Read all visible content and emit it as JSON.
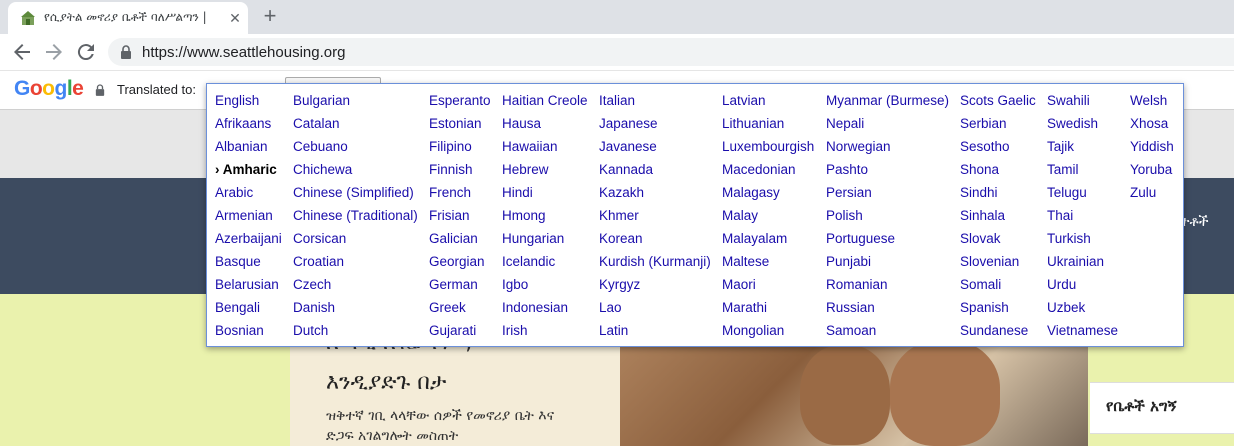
{
  "browser": {
    "tab": {
      "title": "የሲያትል መኖሪያ ቤቶች ባለሥልጣን |",
      "favicon": "house-icon"
    },
    "new_tab_icon": "plus-icon",
    "close_icon": "close-icon",
    "back_icon": "back-arrow-icon",
    "forward_icon": "forward-arrow-icon",
    "reload_icon": "reload-icon",
    "url": "https://www.seattlehousing.org"
  },
  "translate_bar": {
    "logo_letters": [
      "G",
      "o",
      "o",
      "g",
      "l",
      "e"
    ],
    "label": "Translated to:",
    "selected_language": "Amharic"
  },
  "language_menu": {
    "columns": [
      [
        "English",
        "Afrikaans",
        "Albanian",
        "Amharic",
        "Arabic",
        "Armenian",
        "Azerbaijani",
        "Basque",
        "Belarusian",
        "Bengali",
        "Bosnian"
      ],
      [
        "Bulgarian",
        "Catalan",
        "Cebuano",
        "Chichewa",
        "Chinese (Simplified)",
        "Chinese (Traditional)",
        "Corsican",
        "Croatian",
        "Czech",
        "Danish",
        "Dutch"
      ],
      [
        "Esperanto",
        "Estonian",
        "Filipino",
        "Finnish",
        "French",
        "Frisian",
        "Galician",
        "Georgian",
        "German",
        "Greek",
        "Gujarati"
      ],
      [
        "Haitian Creole",
        "Hausa",
        "Hawaiian",
        "Hebrew",
        "Hindi",
        "Hmong",
        "Hungarian",
        "Icelandic",
        "Igbo",
        "Indonesian",
        "Irish"
      ],
      [
        "Italian",
        "Japanese",
        "Javanese",
        "Kannada",
        "Kazakh",
        "Khmer",
        "Korean",
        "Kurdish (Kurmanji)",
        "Kyrgyz",
        "Lao",
        "Latin"
      ],
      [
        "Latvian",
        "Lithuanian",
        "Luxembourgish",
        "Macedonian",
        "Malagasy",
        "Malay",
        "Malayalam",
        "Maltese",
        "Maori",
        "Marathi",
        "Mongolian"
      ],
      [
        "Myanmar (Burmese)",
        "Nepali",
        "Norwegian",
        "Pashto",
        "Persian",
        "Polish",
        "Portuguese",
        "Punjabi",
        "Romanian",
        "Russian",
        "Samoan"
      ],
      [
        "Scots Gaelic",
        "Serbian",
        "Sesotho",
        "Shona",
        "Sindhi",
        "Sinhala",
        "Slovak",
        "Slovenian",
        "Somali",
        "Spanish",
        "Sundanese"
      ],
      [
        "Swahili",
        "Swedish",
        "Tajik",
        "Tamil",
        "Telugu",
        "Thai",
        "Turkish",
        "Ukrainian",
        "Urdu",
        "Uzbek",
        "Vietnamese"
      ],
      [
        "Welsh",
        "Xhosa",
        "Yiddish",
        "Yoruba",
        "Zulu"
      ]
    ]
  },
  "page": {
    "header_nav_text": "ተቶች",
    "hero_title_top": "ለ ግዲ ለገሬ ተዎ ,",
    "hero_title": "እንዲያድጉ በታ",
    "hero_subtitle_line1": "ዝቅተኛ ገቢ ላላቸው ሰዎች የመኖሪያ ቤት እና",
    "hero_subtitle_line2": "ድጋፍ አገልግሎት መስጠት",
    "side_panel_label": "የቤቶች አግኝ"
  },
  "colors": {
    "link": "#1a0dab",
    "header_bg": "#3d4b60",
    "hero_bg": "#eaf2ad",
    "menu_border": "#6b90da"
  }
}
